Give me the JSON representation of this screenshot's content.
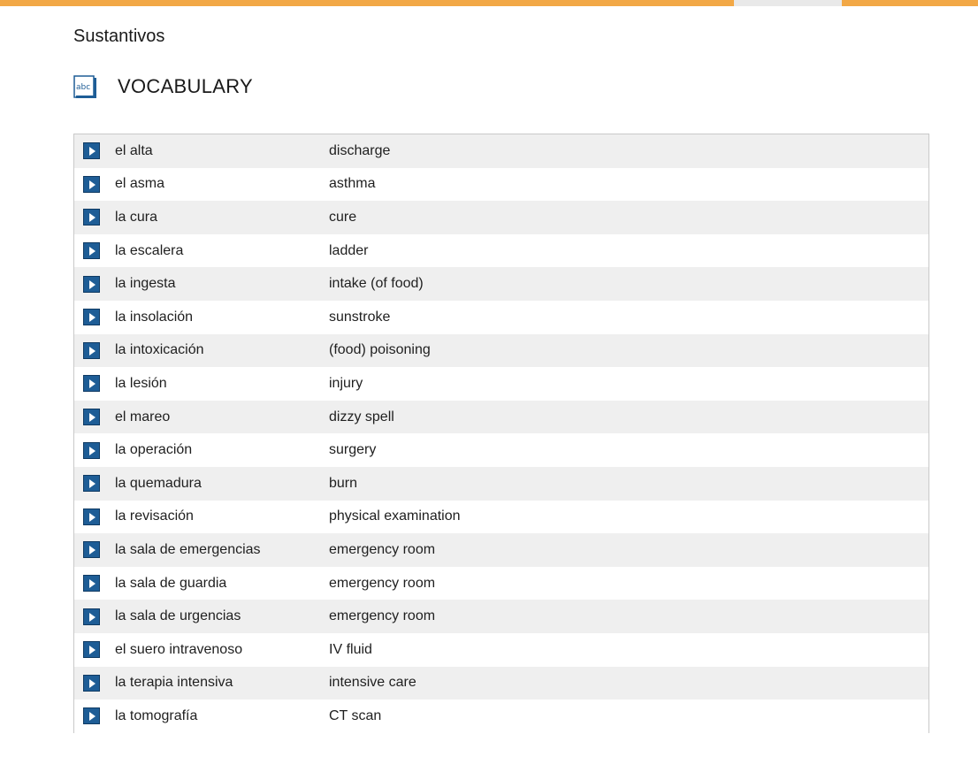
{
  "section": {
    "title": "Sustantivos"
  },
  "vocabulary": {
    "heading": "VOCABULARY",
    "icon": "abc-book-icon",
    "icon_text": "abc",
    "items": [
      {
        "term": "el alta",
        "translation": "discharge"
      },
      {
        "term": "el asma",
        "translation": "asthma"
      },
      {
        "term": "la cura",
        "translation": "cure"
      },
      {
        "term": "la escalera",
        "translation": "ladder"
      },
      {
        "term": "la ingesta",
        "translation": "intake (of food)"
      },
      {
        "term": "la insolación",
        "translation": "sunstroke"
      },
      {
        "term": "la intoxicación",
        "translation": "(food) poisoning"
      },
      {
        "term": "la lesión",
        "translation": "injury"
      },
      {
        "term": "el mareo",
        "translation": "dizzy spell"
      },
      {
        "term": "la operación",
        "translation": "surgery"
      },
      {
        "term": "la quemadura",
        "translation": "burn"
      },
      {
        "term": "la revisación",
        "translation": "physical examination"
      },
      {
        "term": "la sala de emergencias",
        "translation": "emergency room"
      },
      {
        "term": "la sala de guardia",
        "translation": "emergency room"
      },
      {
        "term": "la sala de urgencias",
        "translation": "emergency room"
      },
      {
        "term": "el suero intravenoso",
        "translation": "IV fluid"
      },
      {
        "term": "la terapia intensiva",
        "translation": "intensive care"
      },
      {
        "term": "la tomografía",
        "translation": "CT scan"
      }
    ]
  },
  "colors": {
    "accent_bar": "#f2a846",
    "play_button": "#1e5d96",
    "row_alt": "#efefef"
  }
}
